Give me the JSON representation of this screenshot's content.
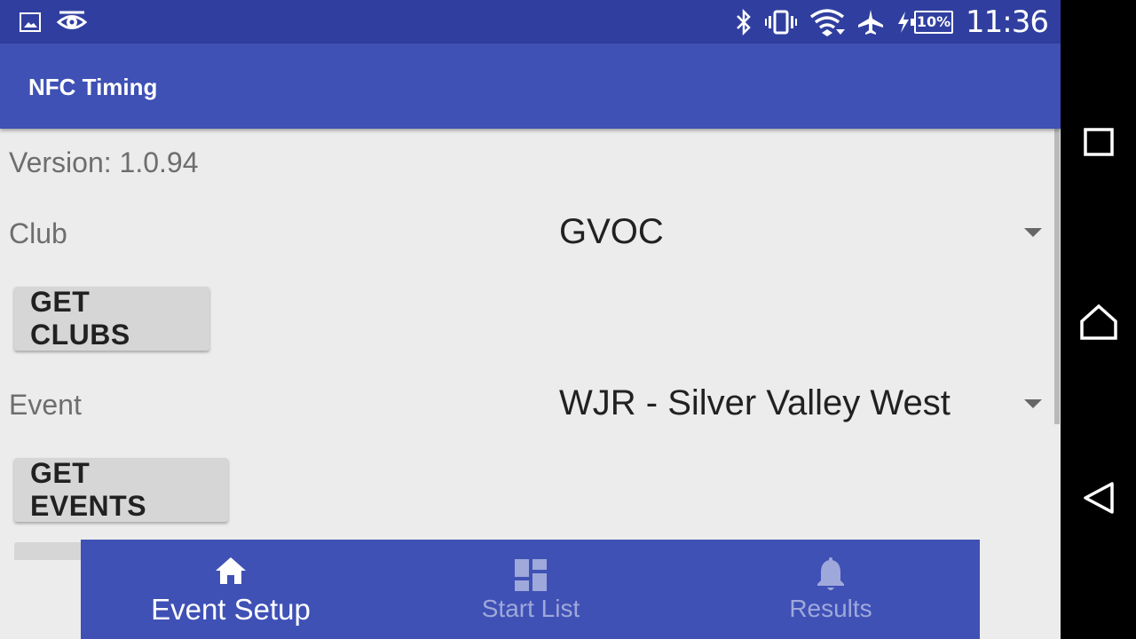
{
  "status_bar": {
    "time": "11:36",
    "battery_percent": "10%",
    "icons": [
      "gallery-icon",
      "eye-icon",
      "bluetooth-icon",
      "vibrate-icon",
      "wifi-icon",
      "airplane-icon",
      "charging-icon"
    ]
  },
  "app_bar": {
    "title": "NFC Timing"
  },
  "main": {
    "version": "Version: 1.0.94",
    "club_label": "Club",
    "club_value": "GVOC",
    "get_clubs_label": "GET CLUBS",
    "event_label": "Event",
    "event_value": "WJR - Silver Valley West",
    "get_events_label": "GET EVENTS"
  },
  "bottom_nav": {
    "items": [
      {
        "label": "Event Setup",
        "icon": "home-icon",
        "active": true
      },
      {
        "label": "Start List",
        "icon": "dashboard-icon",
        "active": false
      },
      {
        "label": "Results",
        "icon": "bell-icon",
        "active": false
      }
    ]
  },
  "system_nav": {
    "buttons": [
      "recents-icon",
      "home-circle-icon",
      "back-icon"
    ]
  },
  "colors": {
    "status_bar": "#303f9f",
    "primary": "#3f51b5",
    "background": "#ececec",
    "inactive_nav": "#9fa8da"
  }
}
